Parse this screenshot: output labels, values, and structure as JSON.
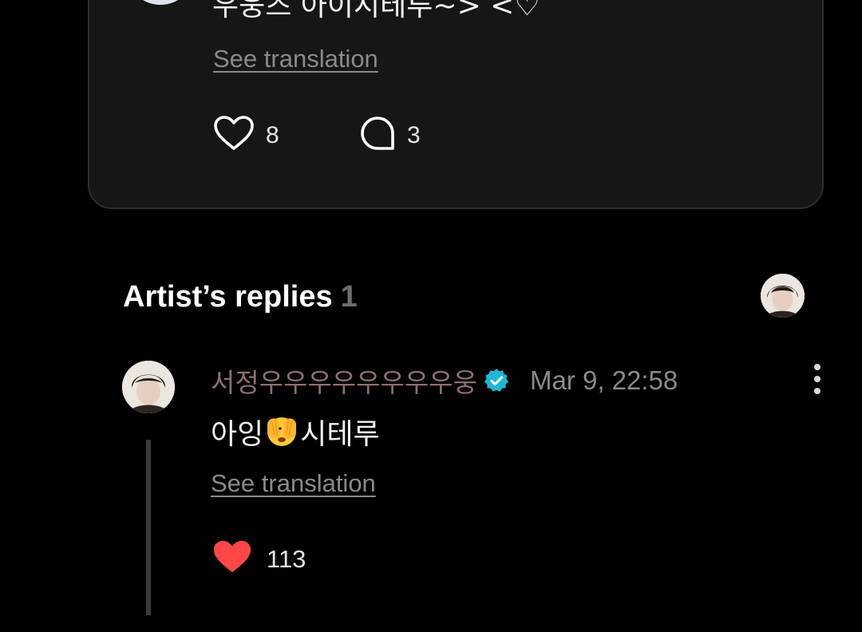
{
  "post": {
    "text": "우웅즈 아이시테루~> <♡",
    "see_translation": "See translation",
    "like_count": "8",
    "reply_count": "3",
    "icons": {
      "like": "heart-outline-icon",
      "reply": "speech-bubble-icon"
    }
  },
  "artist_replies": {
    "title": "Artist’s replies",
    "count": "1"
  },
  "reply": {
    "author": "서정우우우우우우우우웅",
    "verified_icon": "verified-badge-icon",
    "verified_color": "#1fb6d8",
    "timestamp": "Mar 9, 22:58",
    "text_before": "아잉",
    "emoji": "face-with-peeking-eye-emoji",
    "text_after": "시테루",
    "see_translation": "See translation",
    "like_count": "113",
    "like_color": "#ff4747",
    "more_icon": "more-vertical-icon"
  }
}
